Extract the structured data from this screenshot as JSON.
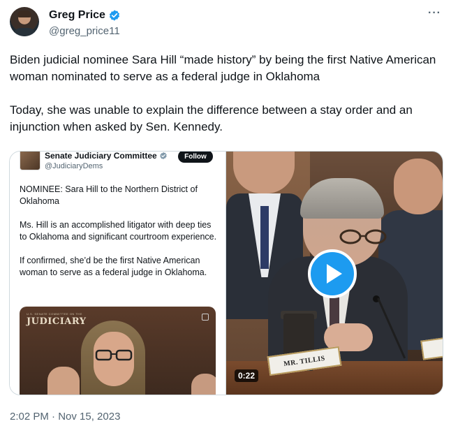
{
  "author": {
    "name": "Greg Price",
    "handle": "@greg_price11",
    "verified_icon": "verified-badge-icon",
    "more_label": "···"
  },
  "tweet": {
    "paragraphs": [
      "Biden judicial nominee Sara Hill “made history” by being the first Native American woman nominated to serve as a federal judge in Oklahoma",
      "Today, she was unable to explain the difference between a stay order and an injunction when asked by Sen. Kennedy."
    ],
    "timestamp": "2:02 PM · Nov 15, 2023"
  },
  "embedded": {
    "name": "Senate Judiciary Committee",
    "handle": "@JudiciaryDems",
    "follow_label": "Follow",
    "paragraphs": [
      "NOMINEE: Sara Hill to the Northern District of Oklahoma",
      "Ms. Hill is an accomplished litigator with deep ties to Oklahoma and significant courtroom experience.",
      "If confirmed, she’d be the first Native American woman to serve as a federal judge in Oklahoma."
    ],
    "logo_text": "JUDICIARY",
    "logo_sub": "U.S. SENATE COMMITTEE ON THE"
  },
  "video": {
    "duration": "0:22",
    "nameplate": "MR. TILLIS"
  },
  "colors": {
    "accent": "#1d9bf0",
    "text": "#0f1419",
    "muted": "#536471",
    "border": "#cfd9de"
  }
}
